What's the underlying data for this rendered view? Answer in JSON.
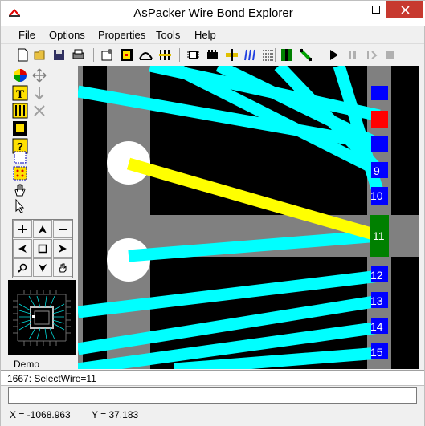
{
  "window": {
    "title": "AsPacker Wire Bond Explorer"
  },
  "menu": [
    "File",
    "Options",
    "Properties",
    "Tools",
    "Help"
  ],
  "canvas": {
    "pad_labels": [
      "9",
      "10",
      "11",
      "12",
      "13",
      "14",
      "15"
    ],
    "selected_pad": "11"
  },
  "sidebar": {
    "label": "Demo"
  },
  "status": {
    "message": "1667: SelectWire=11",
    "command_value": "",
    "x": "X = -1068.963",
    "y": "Y = 37.183"
  },
  "colors": {
    "wire": "#00ffff",
    "selected_wire": "#ffff00",
    "pad": "#0000ff",
    "selected_pad": "#008000",
    "grey_die": "#808080"
  }
}
